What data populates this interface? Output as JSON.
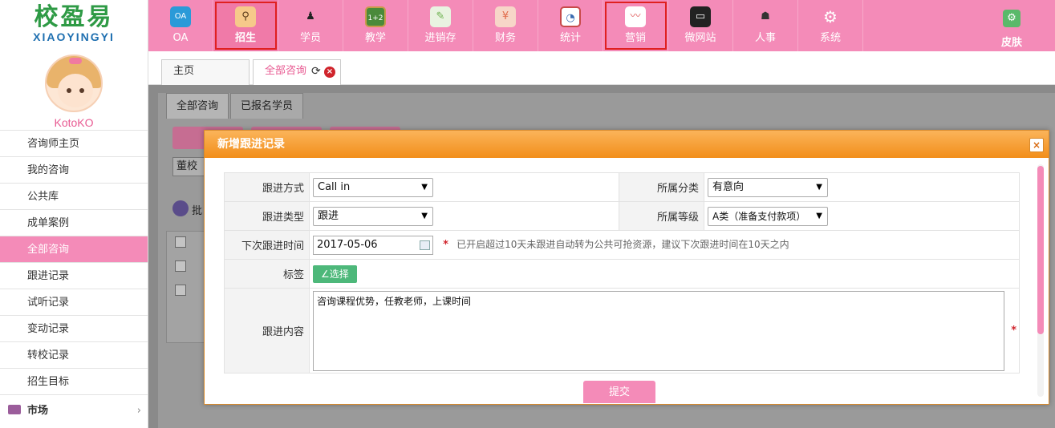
{
  "brand": {
    "name_zh": "校盈易",
    "name_en": "XIAOYINGYI"
  },
  "user": {
    "name": "KotoKO"
  },
  "sidebar": {
    "items": [
      {
        "label": "咨询师主页"
      },
      {
        "label": "我的咨询"
      },
      {
        "label": "公共库"
      },
      {
        "label": "成单案例"
      },
      {
        "label": "全部咨询",
        "active": true
      },
      {
        "label": "跟进记录"
      },
      {
        "label": "试听记录"
      },
      {
        "label": "变动记录"
      },
      {
        "label": "转校记录"
      },
      {
        "label": "招生目标"
      }
    ],
    "market": {
      "label": "市场"
    }
  },
  "topnav": {
    "items": [
      {
        "label": "OA",
        "icon": "oa-icon",
        "color": "#2a9ad8"
      },
      {
        "label": "招生",
        "icon": "search-person-icon",
        "color": "#e89c3a"
      },
      {
        "label": "学员",
        "icon": "graduate-icon",
        "color": "#333333"
      },
      {
        "label": "教学",
        "icon": "chalkboard-icon",
        "color": "#4a8a3a"
      },
      {
        "label": "进销存",
        "icon": "clipboard-icon",
        "color": "#6ab04c"
      },
      {
        "label": "财务",
        "icon": "finance-icon",
        "color": "#e06a4a"
      },
      {
        "label": "统计",
        "icon": "stats-icon",
        "color": "#3a6ab0"
      },
      {
        "label": "营销",
        "icon": "marketing-icon",
        "color": "#e05a5a"
      },
      {
        "label": "微网站",
        "icon": "monitor-icon",
        "color": "#222222"
      },
      {
        "label": "人事",
        "icon": "person-org-icon",
        "color": "#444444"
      },
      {
        "label": "系统",
        "icon": "gear-icon",
        "color": "#ffffff"
      }
    ],
    "skin": {
      "label": "皮肤",
      "icon": "skin-icon"
    }
  },
  "tabs": {
    "home": "主页",
    "current": "全部咨询"
  },
  "background": {
    "subtabs": [
      "全部咨询",
      "已报名学员"
    ],
    "campus_select": "董校",
    "batch_label": "批"
  },
  "modal": {
    "title": "新增跟进记录",
    "close": "×",
    "fields": {
      "follow_method_label": "跟进方式",
      "follow_method_value": "Call in",
      "category_label": "所属分类",
      "category_value": "有意向",
      "follow_type_label": "跟进类型",
      "follow_type_value": "跟进",
      "grade_label": "所属等级",
      "grade_value": "A类（准备支付款项）",
      "next_time_label": "下次跟进时间",
      "next_time_value": "2017-05-06",
      "next_time_hint": "已开启超过10天未跟进自动转为公共可抢资源，建议下次跟进时间在10天之内",
      "tag_label": "标签",
      "tag_button": "∠选择",
      "content_label": "跟进内容",
      "content_value": "咨询课程优势，任教老师，上课时间"
    },
    "required_mark": "*",
    "submit": "提交"
  },
  "colors": {
    "accent": "#f48bb8",
    "modal_header": "#f28e1a",
    "required": "#d0242c",
    "brand_green": "#2e9a45",
    "brand_blue": "#1e6fb0"
  }
}
